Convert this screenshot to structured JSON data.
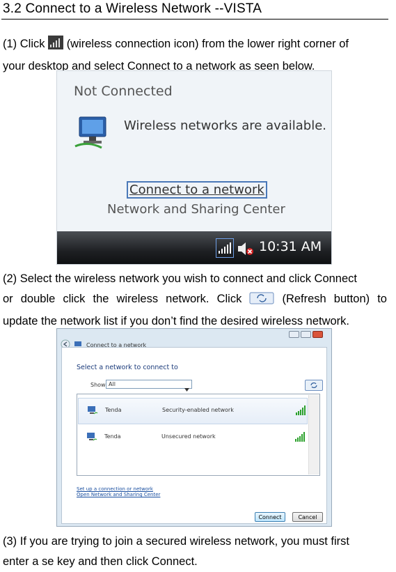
{
  "heading": "3.2 Connect to a Wireless Network --VISTA",
  "step1": {
    "click": "(1) Click",
    "rest": "(wireless connection icon) from the lower right corner of",
    "line2": "your desktop and select Connect to a network as seen below."
  },
  "screenshot1": {
    "status": "Not Connected",
    "available": "Wireless networks are available.",
    "connect_link": "Connect to a network",
    "network_center": "Network and Sharing Center",
    "time": "10:31 AM"
  },
  "step2": {
    "line1": "(2) Select the wireless network you wish to connect and click Connect",
    "line2_a": "or double click the wireless network. Click",
    "line2_b": "(Refresh button) to",
    "line3": "update the network list if you don’t find the desired wireless network."
  },
  "screenshot2": {
    "window_title": "Connect to a network",
    "heading": "Select a network to connect to",
    "show_label": "Show",
    "show_value": "All",
    "networks": [
      {
        "name": "Tenda",
        "status": "Security-enabled network"
      },
      {
        "name": "Tenda",
        "status": "Unsecured network"
      }
    ],
    "link_setup": "Set up a connection or network",
    "link_nsc": "Open Network and Sharing Center",
    "connect_button": "Connect",
    "cancel_button": "Cancel"
  },
  "step3": {
    "line1": "(3) If you are trying to join a secured wireless network, you must first",
    "line2": "enter a se key and then click Connect."
  },
  "colors": {
    "signal_green": "#2aa02a",
    "link_blue": "#1a4fa0",
    "highlight_border": "#4a78b8"
  }
}
